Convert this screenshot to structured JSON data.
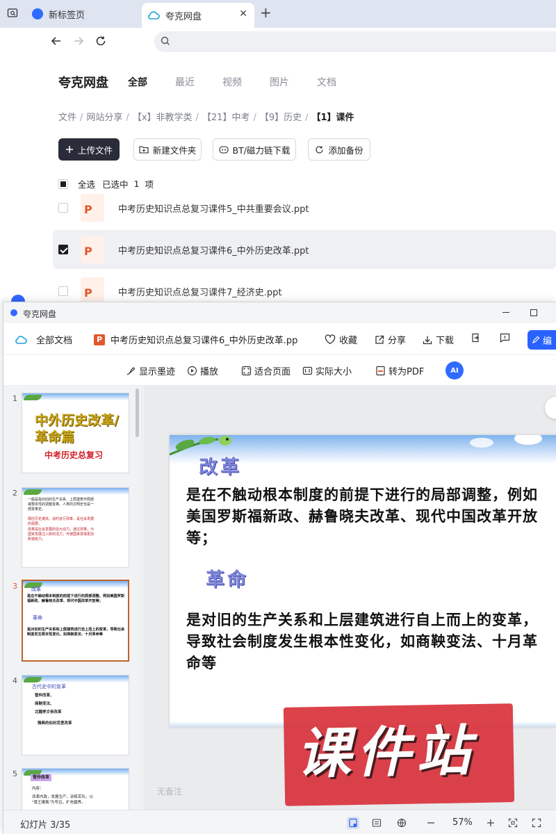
{
  "browser": {
    "tabs": [
      {
        "label": "新标签页",
        "active": false
      },
      {
        "label": "夸克网盘",
        "active": true
      }
    ],
    "new_tab_icon": "plus-icon",
    "url": ""
  },
  "disk": {
    "brand": "夸克网盘",
    "nav_tabs": [
      "全部",
      "最近",
      "视频",
      "图片",
      "文档"
    ],
    "active_nav": "全部",
    "breadcrumb": [
      "文件",
      "网站分享",
      "【x】非教学类",
      "【21】中考",
      "【9】历史",
      "【1】课件"
    ],
    "actions": {
      "upload": "上传文件",
      "new_folder": "新建文件夹",
      "bt": "BT/磁力链下载",
      "backup": "添加备份"
    },
    "select_all": "全选",
    "selected_prefix": "已选中",
    "selected_count": "1",
    "selected_suffix": "项",
    "files": [
      {
        "name": "中考历史知识点总复习课件5_中共重要会议.ppt",
        "checked": false
      },
      {
        "name": "中考历史知识点总复习课件6_中外历史改革.ppt",
        "checked": true
      },
      {
        "name": "中考历史知识点总复习课件7_经济史.ppt",
        "checked": false
      }
    ]
  },
  "viewer": {
    "window_title": "夸克网盘",
    "all_docs": "全部文档",
    "doc_title": "中考历史知识点总复习课件6_中外历史改革.pp",
    "file_badge": "P",
    "favorite": "收藏",
    "share": "分享",
    "download": "下载",
    "edit": "编",
    "toolbar2": {
      "ink": "显示墨迹",
      "play": "播放",
      "fit": "适合页面",
      "actual": "实际大小",
      "to_pdf": "转为PDF",
      "ai": "AI"
    },
    "thumbnails": [
      {
        "num": "1",
        "title": "中外历史改革/革命篇",
        "subtitle": "中考历史总复习"
      },
      {
        "num": "2",
        "lines": [
          "一般是指对旧的生产关系、上层建筑作局部",
          "或根本性的调整变革。人类的文明史也是一",
          "部变革史。",
          "顺应历史潮流，适时进行改革，是社会发展",
          "的需要。",
          "改革是社会发展的强大动力，通过改革，为",
          "国家发展注入新的活力，可使国家变得更加",
          "和谐有力。"
        ]
      },
      {
        "num": "3",
        "h1": "改革",
        "b1": "是在不触动根本制度的前提下进行的局部调整，例如美国罗斯福新政、赫鲁晓夫改革、现代中国改革开放等；",
        "h2": "革命",
        "b2": "是对旧的生产关系和上层建筑进行自上而上的变革，导致社会制度发生根本性变化，如商鞅变法、十月革命等"
      },
      {
        "num": "4",
        "title": "古代史中的变革",
        "lines": [
          "管仲改革、",
          "商鞅变法、",
          "北魏孝文帝改革",
          "雅典的伯利克里改革"
        ]
      },
      {
        "num": "5",
        "tag": "管仲改革",
        "lines": [
          "内容：",
          "改革内政，发展生产，训练军队，以",
          "\"尊王攘夷\"为号召，扩充疆界。"
        ]
      }
    ],
    "current_thumb": "3",
    "slide": {
      "h1": "改革",
      "body1": "是在不触动根本制度的前提下进行的局部调整，例如美国罗斯福新政、赫鲁晓夫改革、现代中国改革开放等；",
      "h2": "革命",
      "body2": "是对旧的生产关系和上层建筑进行自上而上的变革，导致社会制度发生根本性变化，如商鞅变法、十月革命等"
    },
    "watermark": "课件站",
    "notes": "无备注",
    "status": {
      "slide_label": "幻灯片 3/35",
      "zoom": "57%"
    }
  }
}
